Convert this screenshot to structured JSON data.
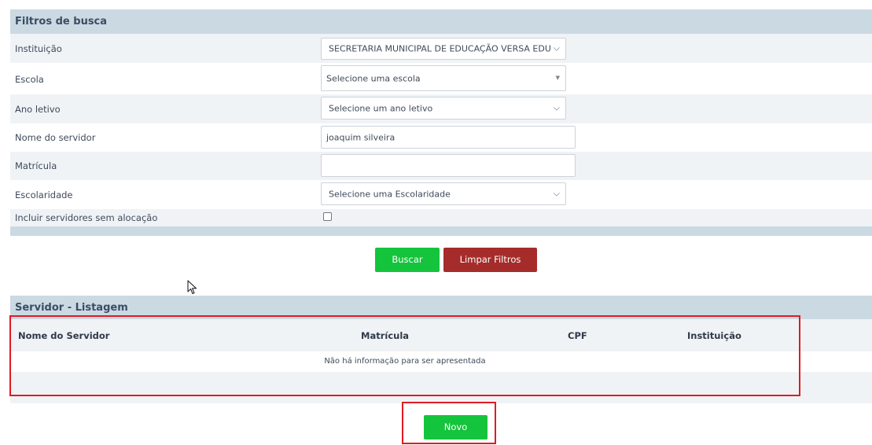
{
  "filters": {
    "title": "Filtros de busca",
    "fields": {
      "instituicao": {
        "label": "Instituição",
        "value": "SECRETARIA MUNICIPAL DE EDUCAÇÃO VERSA EDUCA"
      },
      "escola": {
        "label": "Escola",
        "placeholder": "Selecione uma escola"
      },
      "ano_letivo": {
        "label": "Ano letivo",
        "placeholder": "Selecione um ano letivo"
      },
      "nome_servidor": {
        "label": "Nome do servidor",
        "value": "joaquim silveira"
      },
      "matricula": {
        "label": "Matrícula",
        "value": ""
      },
      "escolaridade": {
        "label": "Escolaridade",
        "placeholder": "Selecione uma Escolaridade"
      },
      "sem_alocacao": {
        "label": "Incluir servidores sem alocação",
        "checked": false
      }
    },
    "buttons": {
      "search": "Buscar",
      "clear": "Limpar Filtros"
    }
  },
  "listing": {
    "title": "Servidor - Listagem",
    "columns": [
      "Nome do Servidor",
      "Matrícula",
      "CPF",
      "Instituição"
    ],
    "empty_message": "Não há informação para ser apresentada",
    "new_button": "Novo"
  },
  "colors": {
    "header_bg": "#cbd9e3",
    "primary_green": "#14c43c",
    "danger_red": "#a52c2a",
    "highlight": "#e01b24"
  }
}
